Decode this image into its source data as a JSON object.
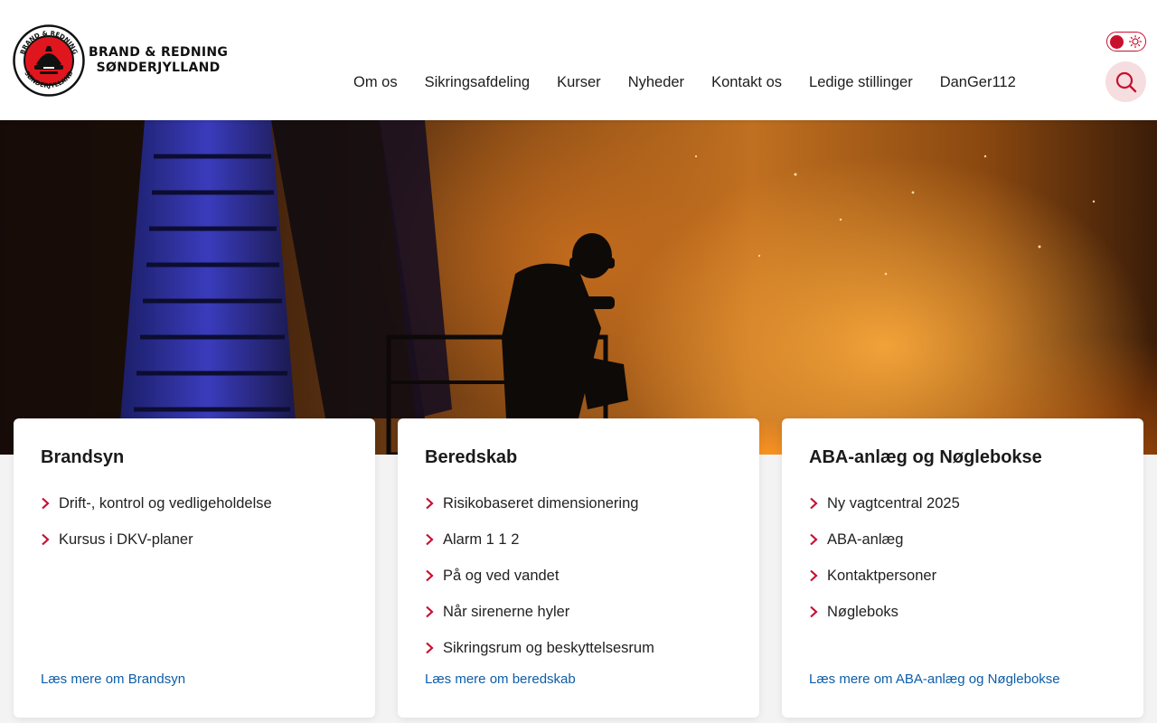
{
  "brand": {
    "name_line1": "BRAND & REDNING",
    "name_line2": "SØNDERJYLLAND",
    "seal_text_top": "BRAND & REDNING",
    "seal_text_bottom": "SØNDERJYLLAND"
  },
  "nav": {
    "items": [
      {
        "label": "Om os"
      },
      {
        "label": "Sikringsafdeling"
      },
      {
        "label": "Kurser"
      },
      {
        "label": "Nyheder"
      },
      {
        "label": "Kontakt os"
      },
      {
        "label": "Ledige stillinger"
      },
      {
        "label": "DanGer112"
      }
    ]
  },
  "theme_toggle": {
    "state": "light",
    "accent": "#c8102e"
  },
  "search": {
    "icon": "search-icon",
    "bg": "#f6dde0"
  },
  "hero": {
    "image": "firefighter-silhouette-fire-photo"
  },
  "cards": [
    {
      "title": "Brandsyn",
      "items": [
        "Drift-, kontrol og vedligeholdelse",
        "Kursus i DKV-planer"
      ],
      "link": "Læs mere om Brandsyn"
    },
    {
      "title": "Beredskab",
      "items": [
        "Risikobaseret dimensionering",
        "Alarm 1 1 2",
        "På og ved vandet",
        "Når sirenerne hyler",
        "Sikringsrum og beskyttelsesrum"
      ],
      "link": "Læs mere om beredskab"
    },
    {
      "title": "ABA-anlæg og Nøglebokse",
      "items": [
        "Ny vagtcentral 2025",
        "ABA-anlæg",
        "Kontaktpersoner",
        "Nøgleboks"
      ],
      "link": "Læs mere om ABA-anlæg og Nøglebokse"
    }
  ],
  "colors": {
    "accent": "#c8102e",
    "link": "#0d5ea8"
  }
}
